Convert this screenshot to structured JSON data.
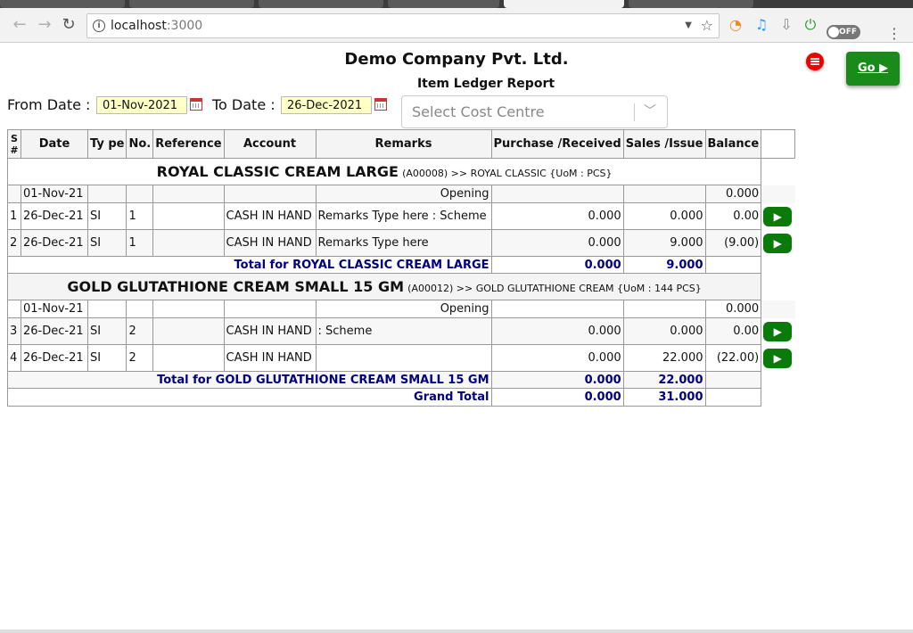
{
  "browser": {
    "url_host": "localhost",
    "url_port": ":3000",
    "toggle_label": "OFF"
  },
  "header": {
    "company": "Demo Company Pvt. Ltd.",
    "report_title": "Item Ledger Report",
    "go_label": "Go ▶"
  },
  "filters": {
    "from_label": "From Date :",
    "from_value": "01-Nov-2021",
    "to_label": "To Date :",
    "to_value": "26-Dec-2021",
    "cost_centre_placeholder": "Select Cost Centre"
  },
  "table": {
    "headers": [
      "S #",
      "Date",
      "Ty pe",
      "No.",
      "Reference",
      "Account",
      "Remarks",
      "Purchase /Received",
      "Sales /Issue",
      "Balance"
    ],
    "groups": [
      {
        "item_name": "ROYAL CLASSIC CREAM LARGE",
        "item_detail": "(A00008) >> ROYAL CLASSIC {UoM : PCS}",
        "opening": {
          "date": "01-Nov-21",
          "label": "Opening",
          "balance": "0.000"
        },
        "rows": [
          {
            "sn": "1",
            "date": "26-Dec-21",
            "type": "SI",
            "no": "1",
            "reference": "",
            "account": "CASH IN HAND",
            "remarks": "Remarks Type here : Scheme",
            "purchase": "0.000",
            "sales": "0.000",
            "balance": "0.00"
          },
          {
            "sn": "2",
            "date": "26-Dec-21",
            "type": "SI",
            "no": "1",
            "reference": "",
            "account": "CASH IN HAND",
            "remarks": "Remarks Type here",
            "purchase": "0.000",
            "sales": "9.000",
            "balance": "(9.00)"
          }
        ],
        "total_label": "Total for ROYAL CLASSIC CREAM LARGE",
        "total_purchase": "0.000",
        "total_sales": "9.000"
      },
      {
        "item_name": "GOLD GLUTATHIONE CREAM SMALL 15 GM",
        "item_detail": "(A00012) >> GOLD GLUTATHIONE CREAM {UoM : 144 PCS}",
        "opening": {
          "date": "01-Nov-21",
          "label": "Opening",
          "balance": "0.000"
        },
        "rows": [
          {
            "sn": "3",
            "date": "26-Dec-21",
            "type": "SI",
            "no": "2",
            "reference": "",
            "account": "CASH IN HAND",
            "remarks": ": Scheme",
            "purchase": "0.000",
            "sales": "0.000",
            "balance": "0.00"
          },
          {
            "sn": "4",
            "date": "26-Dec-21",
            "type": "SI",
            "no": "2",
            "reference": "",
            "account": "CASH IN HAND",
            "remarks": "",
            "purchase": "0.000",
            "sales": "22.000",
            "balance": "(22.00)"
          }
        ],
        "total_label": "Total for GOLD GLUTATHIONE CREAM SMALL 15 GM",
        "total_purchase": "0.000",
        "total_sales": "22.000"
      }
    ],
    "grand_total_label": "Grand Total",
    "grand_total_purchase": "0.000",
    "grand_total_sales": "31.000",
    "row_action_icon": "play-icon"
  }
}
